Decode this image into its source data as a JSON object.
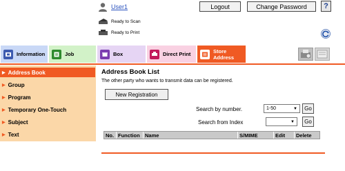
{
  "header": {
    "user_name": "User1",
    "logout_label": "Logout",
    "change_password_label": "Change Password",
    "help_label": "?",
    "status_scan": "Ready to Scan",
    "status_print": "Ready to Print"
  },
  "tabs": [
    {
      "label": "Information",
      "bg": "#c9d8f6",
      "icon_color": "#3d5bb0"
    },
    {
      "label": "Job",
      "bg": "#d2f2c8",
      "icon_color": "#2e8b2e"
    },
    {
      "label": "Box",
      "bg": "#e6d5f4",
      "icon_color": "#7b3db0"
    },
    {
      "label": "Direct Print",
      "bg": "#f9d1e2",
      "icon_color": "#c2185b"
    },
    {
      "label_line1": "Store",
      "label_line2": "Address",
      "bg": "#f05a23",
      "icon_color": "#ffffff"
    }
  ],
  "sidebar": {
    "items": [
      {
        "label": "Address Book",
        "active": true
      },
      {
        "label": "Group",
        "active": false
      },
      {
        "label": "Program",
        "active": false
      },
      {
        "label": "Temporary One-Touch",
        "active": false
      },
      {
        "label": "Subject",
        "active": false
      },
      {
        "label": "Text",
        "active": false
      }
    ]
  },
  "main": {
    "title": "Address Book List",
    "description": "The other party who wants to transmit data can be registered.",
    "new_registration_label": "New Registration",
    "search_number_label": "Search by number.",
    "search_number_value": "1-50",
    "search_index_label": "Search from Index",
    "search_index_value": "",
    "go_label": "Go",
    "columns": [
      "No.",
      "Function",
      "Name",
      "S/MIME",
      "Edit",
      "Delete"
    ]
  },
  "colors": {
    "accent": "#f05a23",
    "sidebar_bg": "#fbd7a8",
    "sidebar_active": "#f05a23"
  }
}
